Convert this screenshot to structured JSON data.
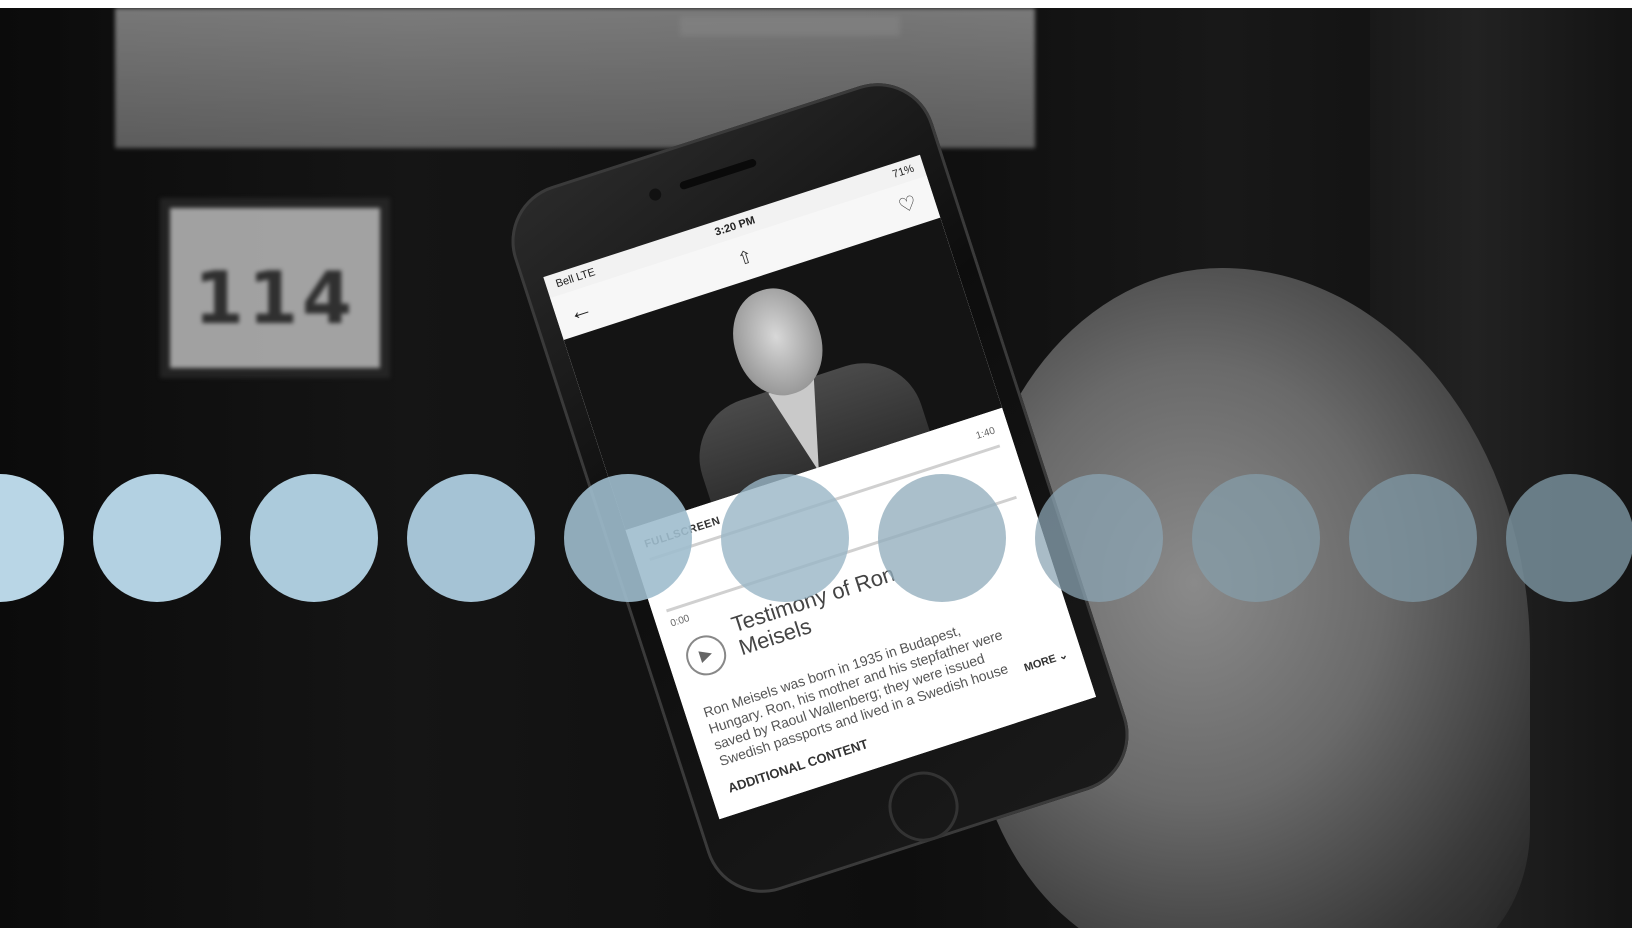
{
  "scene": {
    "room_number": "114"
  },
  "phone": {
    "status_bar": {
      "carrier": "Bell LTE",
      "time": "3:20 PM",
      "battery": "71%"
    },
    "nav": {
      "back_icon": "arrow-left-icon",
      "share_icon": "share-icon",
      "favorite_icon": "heart-icon"
    },
    "player": {
      "fullscreen_label": "FULLSCREEN",
      "duration": "1:40",
      "elapsed": "0:00",
      "progress": 0.0,
      "play_icon": "play-icon",
      "title": "Testimony of Ron Meisels",
      "description": "Ron Meisels was born in 1935 in Budapest, Hungary. Ron, his mother and his stepfather were saved by Raoul Wallenberg; they were issued Swedish passports and lived in a Swedish house before being sent to the ghetto, where they stayed until liberation. They moved",
      "more_label": "MORE",
      "more_icon": "chevron-down-icon",
      "additional_content_label": "ADDITIONAL CONTENT"
    }
  },
  "overlay": {
    "dot_colors": [
      "#b9d6e6",
      "#b3d1e2",
      "#accbdc",
      "#a5c3d5",
      "#9fbdcd",
      "#98b5c5",
      "#92adbd",
      "#8ba5b4",
      "#859eab",
      "#7e96a3",
      "#778e9a"
    ],
    "dot_opacities": [
      1,
      1,
      1,
      1,
      0.9,
      0.8,
      0.78,
      0.74,
      0.72,
      0.8,
      0.85
    ]
  }
}
